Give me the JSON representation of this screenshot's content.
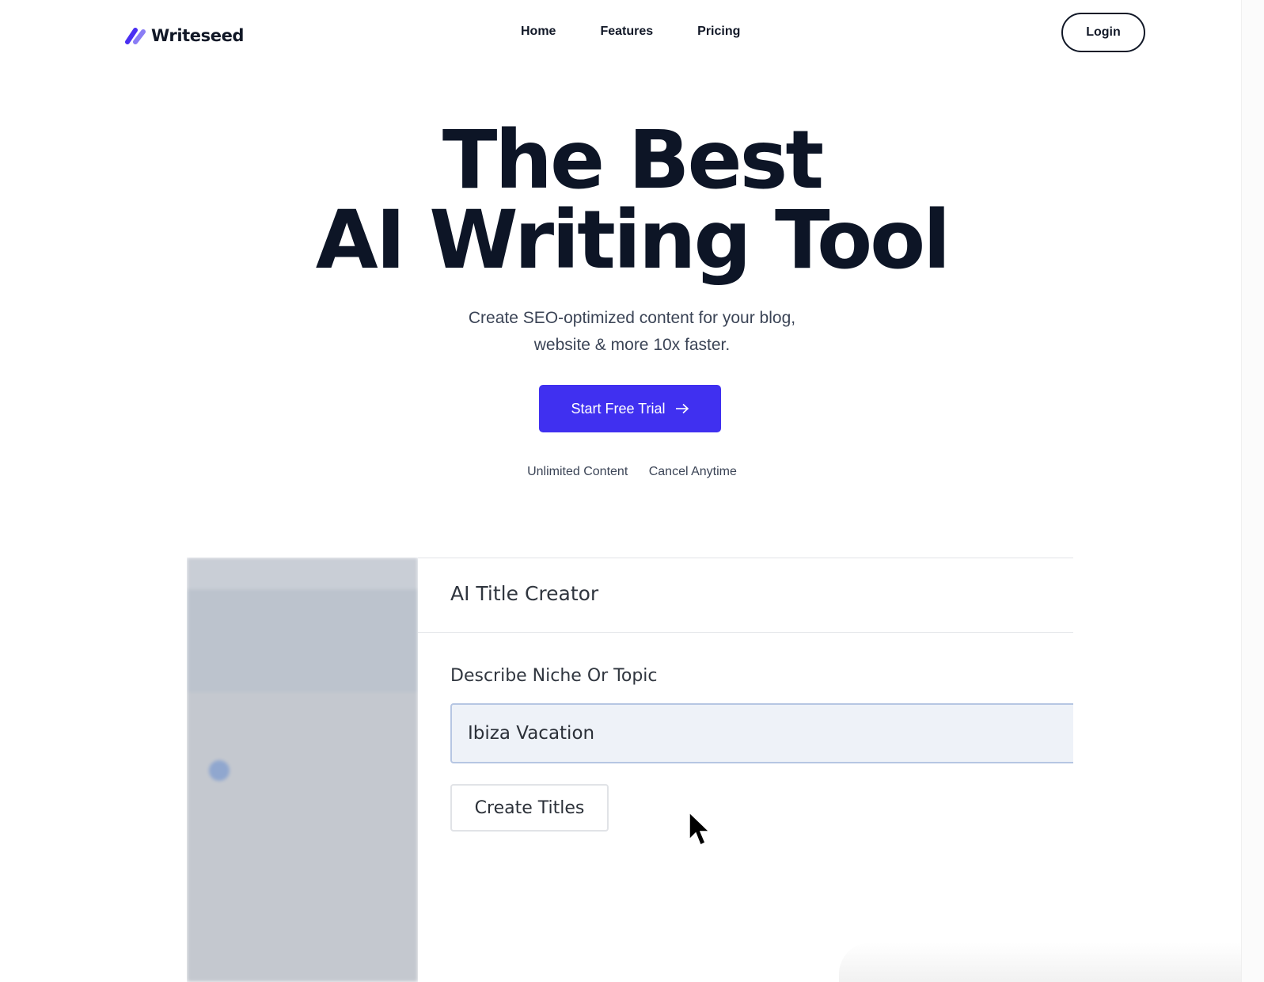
{
  "brand": {
    "name": "Writeseed",
    "accent": "#4030f0",
    "text_dark": "#0d1526"
  },
  "nav": {
    "items": [
      {
        "label": "Home"
      },
      {
        "label": "Features"
      },
      {
        "label": "Pricing"
      }
    ],
    "login_label": "Login"
  },
  "hero": {
    "title_line1": "The Best",
    "title_line2": "AI Writing Tool",
    "subtitle_line1": "Create SEO-optimized content for your blog,",
    "subtitle_line2": "website & more 10x faster.",
    "cta_label": "Start Free Trial",
    "cta_icon": "arrow-right-icon",
    "features": [
      "Unlimited Content",
      "Cancel Anytime"
    ]
  },
  "preview": {
    "panel_title": "AI Title Creator",
    "field_label": "Describe Niche Or Topic",
    "input_value": "Ibiza Vacation",
    "button_label": "Create Titles"
  },
  "icons": {
    "logo": "writeseed-logo-icon",
    "pointer": "mouse-pointer-icon"
  }
}
